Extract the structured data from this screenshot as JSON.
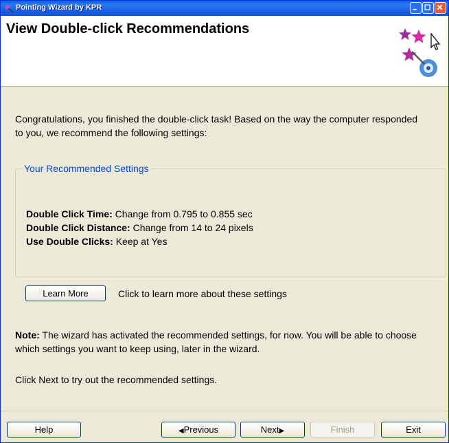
{
  "window": {
    "title": "Pointing Wizard by KPR",
    "title_icon": "wizard-app-icon",
    "controls": [
      "minimize-icon",
      "maximize-icon",
      "close-icon"
    ],
    "colors": {
      "titlebar": "#0a5fe0",
      "legend": "#0046d5",
      "background": "#ece9d8"
    }
  },
  "header": {
    "title": "View Double-click Recommendations",
    "logo_icon": "wizard-stars-cursor-gear-icon"
  },
  "intro_text": "Congratulations, you finished the double-click task! Based on the way the computer responded to you, we recommend the following settings:",
  "recommended": {
    "legend": "Your Recommended Settings",
    "items": [
      {
        "label": "Double Click Time:",
        "value": " Change from 0.795 to 0.855 sec"
      },
      {
        "label": "Double Click Distance:",
        "value": " Change from 14 to 24 pixels"
      },
      {
        "label": "Use Double Clicks:",
        "value": " Keep at Yes"
      }
    ]
  },
  "learn_more": {
    "button_label": "Learn More",
    "hint": "Click to learn more about these settings"
  },
  "note": {
    "label": "Note:",
    "text": " The wizard has activated the recommended settings, for now. You will be able to choose which settings you want to keep using, later in the wizard."
  },
  "next_hint": "Click Next to try out the recommended settings.",
  "footer": {
    "help": "Help",
    "previous": "Previous",
    "next": "Next",
    "finish": "Finish",
    "exit": "Exit"
  }
}
